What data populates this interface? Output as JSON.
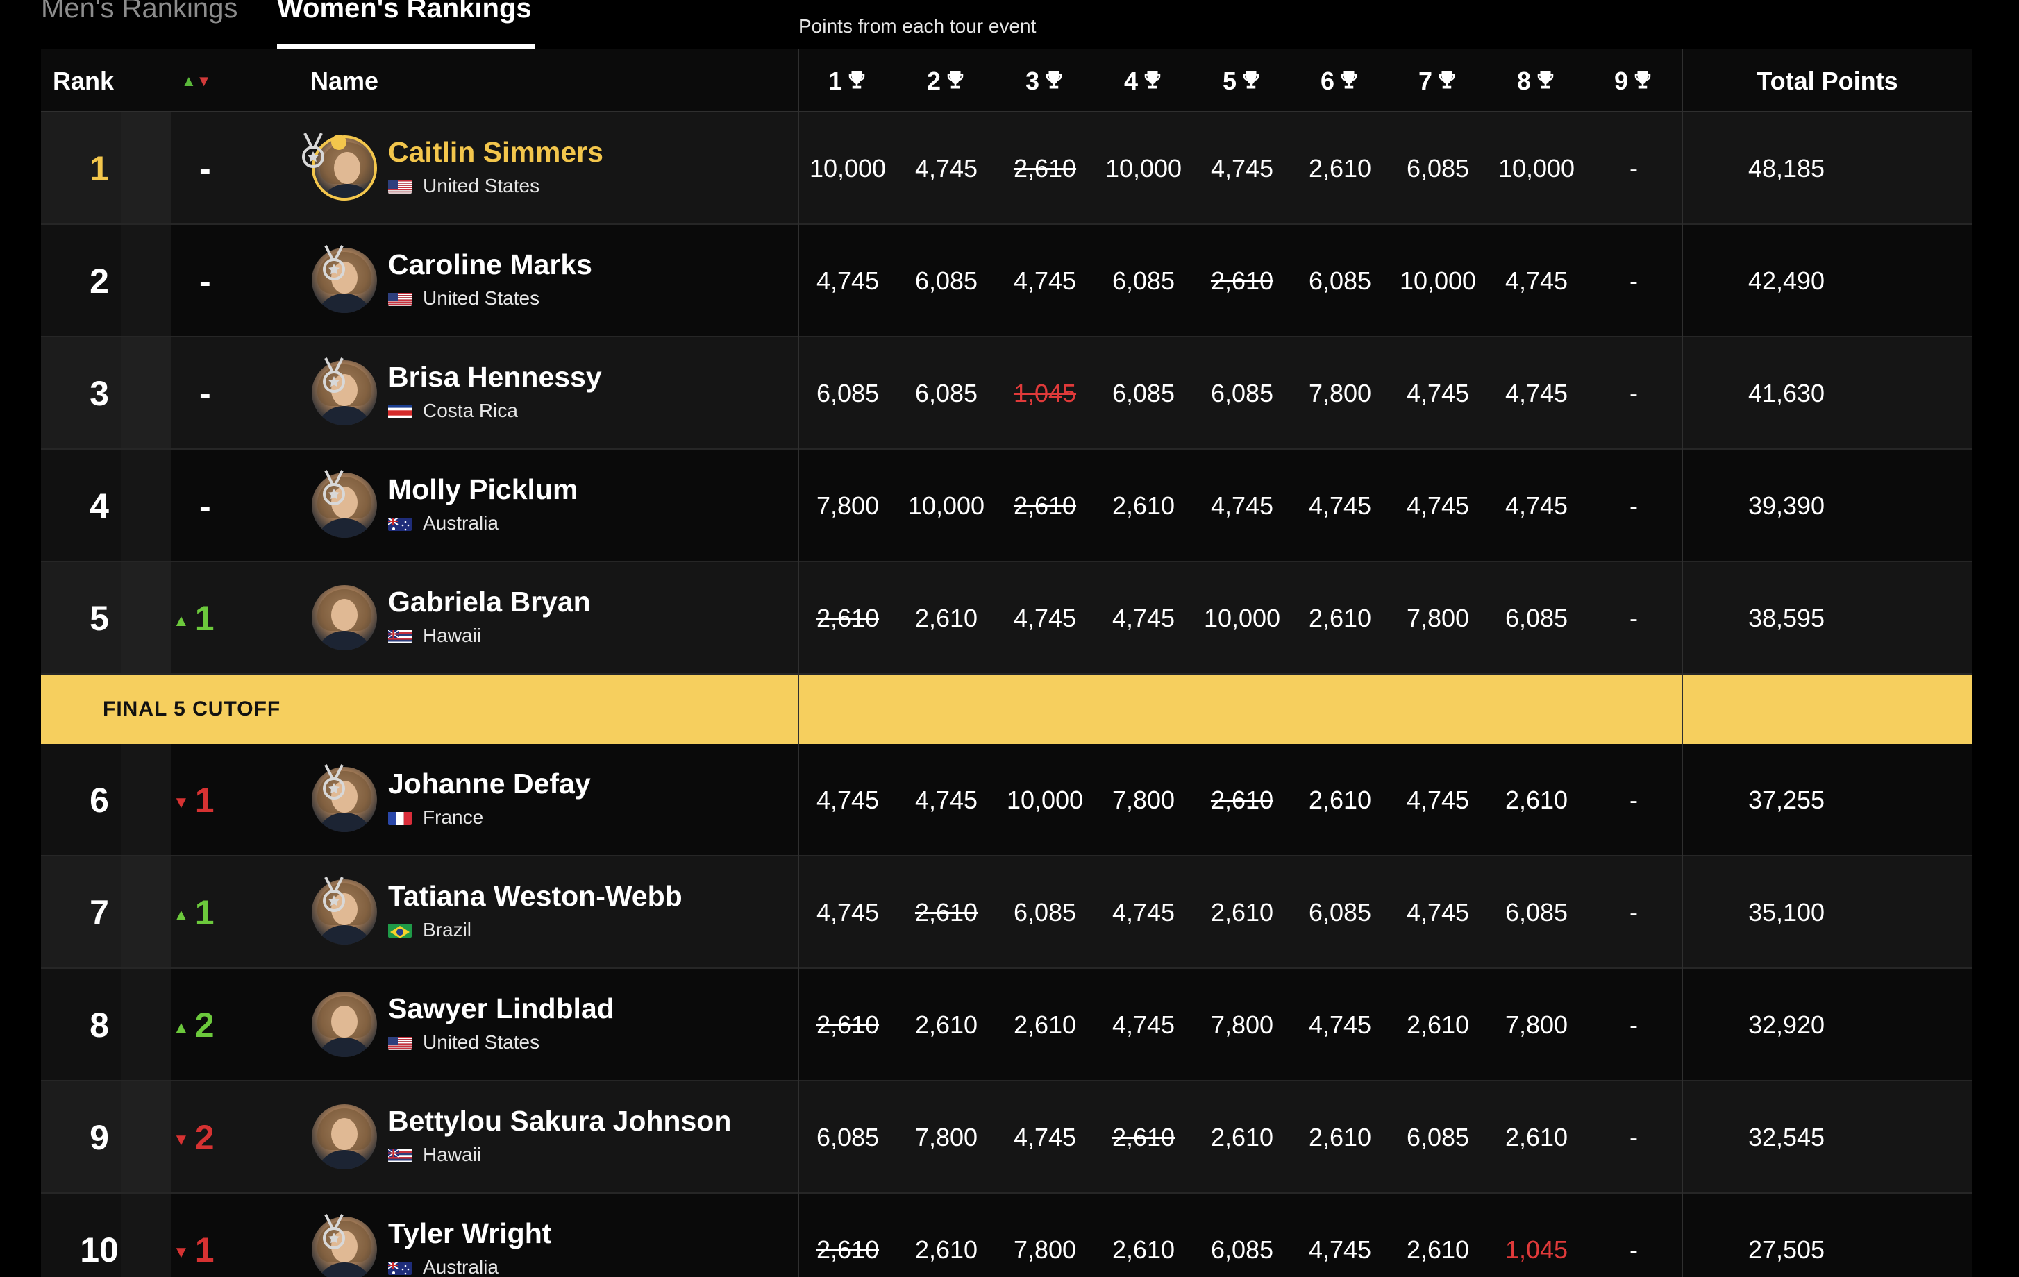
{
  "tabs": {
    "mens": "Men's Rankings",
    "womens": "Women's Rankings"
  },
  "caption": "Points from each tour event",
  "header": {
    "rank": "Rank",
    "name": "Name",
    "events": [
      "1",
      "2",
      "3",
      "4",
      "5",
      "6",
      "7",
      "8",
      "9"
    ],
    "total": "Total Points"
  },
  "cutoff_label": "FINAL 5 CUTOFF",
  "colors": {
    "gold": "#f3c64c",
    "up": "#6cc93c",
    "down": "#d63232",
    "cutoff_bg": "#f6cf5e"
  },
  "rows": [
    {
      "rank": "1",
      "move": "-",
      "move_dir": "none",
      "medal": true,
      "leader": true,
      "name": "Caitlin Simmers",
      "country": "United States",
      "flag": "us",
      "points": [
        "10,000",
        "4,745",
        "2,610",
        "10,000",
        "4,745",
        "2,610",
        "6,085",
        "10,000",
        "-"
      ],
      "dropped": [
        2
      ],
      "red": [],
      "total": "48,185"
    },
    {
      "rank": "2",
      "move": "-",
      "move_dir": "none",
      "medal": true,
      "leader": false,
      "name": "Caroline Marks",
      "country": "United States",
      "flag": "us",
      "points": [
        "4,745",
        "6,085",
        "4,745",
        "6,085",
        "2,610",
        "6,085",
        "10,000",
        "4,745",
        "-"
      ],
      "dropped": [
        4
      ],
      "red": [],
      "total": "42,490"
    },
    {
      "rank": "3",
      "move": "-",
      "move_dir": "none",
      "medal": true,
      "leader": false,
      "name": "Brisa Hennessy",
      "country": "Costa Rica",
      "flag": "cr",
      "points": [
        "6,085",
        "6,085",
        "1,045",
        "6,085",
        "6,085",
        "7,800",
        "4,745",
        "4,745",
        "-"
      ],
      "dropped": [
        2
      ],
      "red": [
        2
      ],
      "total": "41,630"
    },
    {
      "rank": "4",
      "move": "-",
      "move_dir": "none",
      "medal": true,
      "leader": false,
      "name": "Molly Picklum",
      "country": "Australia",
      "flag": "au",
      "points": [
        "7,800",
        "10,000",
        "2,610",
        "2,610",
        "4,745",
        "4,745",
        "4,745",
        "4,745",
        "-"
      ],
      "dropped": [
        2
      ],
      "red": [],
      "total": "39,390"
    },
    {
      "rank": "5",
      "move": "1",
      "move_dir": "up",
      "medal": false,
      "leader": false,
      "name": "Gabriela Bryan",
      "country": "Hawaii",
      "flag": "hi",
      "points": [
        "2,610",
        "2,610",
        "4,745",
        "4,745",
        "10,000",
        "2,610",
        "7,800",
        "6,085",
        "-"
      ],
      "dropped": [
        0
      ],
      "red": [],
      "total": "38,595"
    },
    {
      "rank": "6",
      "move": "1",
      "move_dir": "down",
      "medal": true,
      "leader": false,
      "name": "Johanne Defay",
      "country": "France",
      "flag": "fr",
      "points": [
        "4,745",
        "4,745",
        "10,000",
        "7,800",
        "2,610",
        "2,610",
        "4,745",
        "2,610",
        "-"
      ],
      "dropped": [
        4
      ],
      "red": [],
      "total": "37,255"
    },
    {
      "rank": "7",
      "move": "1",
      "move_dir": "up",
      "medal": true,
      "leader": false,
      "name": "Tatiana Weston-Webb",
      "country": "Brazil",
      "flag": "br",
      "points": [
        "4,745",
        "2,610",
        "6,085",
        "4,745",
        "2,610",
        "6,085",
        "4,745",
        "6,085",
        "-"
      ],
      "dropped": [
        1
      ],
      "red": [],
      "total": "35,100"
    },
    {
      "rank": "8",
      "move": "2",
      "move_dir": "up",
      "medal": false,
      "leader": false,
      "name": "Sawyer Lindblad",
      "country": "United States",
      "flag": "us",
      "points": [
        "2,610",
        "2,610",
        "2,610",
        "4,745",
        "7,800",
        "4,745",
        "2,610",
        "7,800",
        "-"
      ],
      "dropped": [
        0
      ],
      "red": [],
      "total": "32,920"
    },
    {
      "rank": "9",
      "move": "2",
      "move_dir": "down",
      "medal": false,
      "leader": false,
      "name": "Bettylou Sakura Johnson",
      "country": "Hawaii",
      "flag": "hi",
      "points": [
        "6,085",
        "7,800",
        "4,745",
        "2,610",
        "2,610",
        "2,610",
        "6,085",
        "2,610",
        "-"
      ],
      "dropped": [
        3
      ],
      "red": [],
      "total": "32,545"
    },
    {
      "rank": "10",
      "move": "1",
      "move_dir": "down",
      "medal": true,
      "leader": false,
      "name": "Tyler Wright",
      "country": "Australia",
      "flag": "au",
      "points": [
        "2,610",
        "2,610",
        "7,800",
        "2,610",
        "6,085",
        "4,745",
        "2,610",
        "1,045",
        "-"
      ],
      "dropped": [
        0
      ],
      "red": [
        7
      ],
      "total": "27,505"
    }
  ]
}
